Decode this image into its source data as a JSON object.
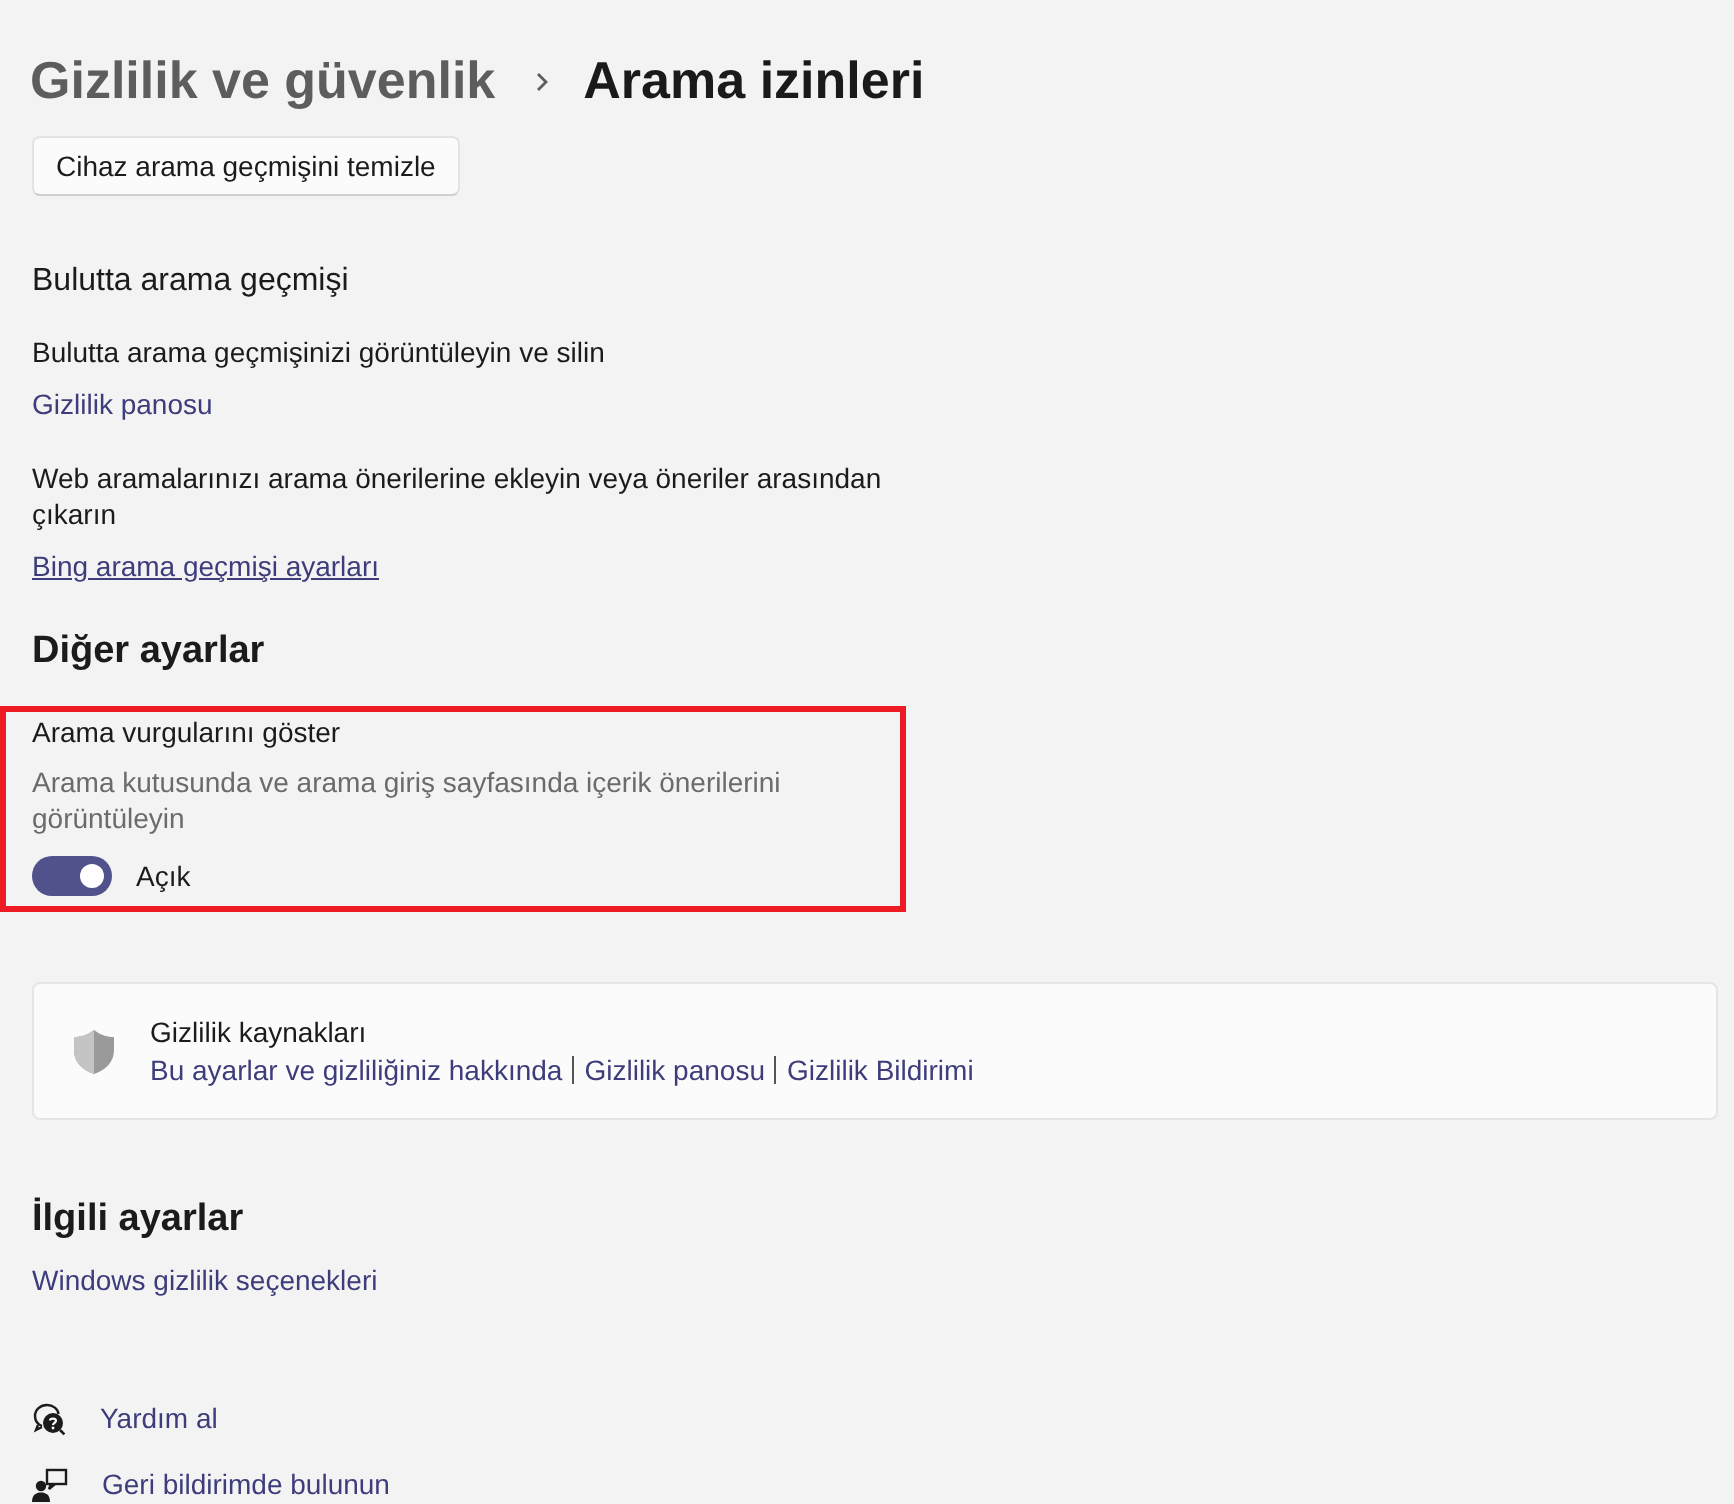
{
  "breadcrumb": {
    "parent": "Gizlilik ve güvenlik",
    "current": "Arama izinleri"
  },
  "clear_history_button": {
    "label": "Cihaz arama geçmişini temizle"
  },
  "cloud_history": {
    "title": "Bulutta arama geçmişi",
    "items": [
      {
        "description": "Bulutta arama geçmişinizi görüntüleyin ve silin",
        "link": "Gizlilik panosu",
        "hovered": false
      },
      {
        "description": "Web aramalarınızı arama önerilerine ekleyin veya öneriler arasından çıkarın",
        "link": "Bing arama geçmişi ayarları",
        "hovered": true
      }
    ]
  },
  "other_settings": {
    "title": "Diğer ayarlar",
    "settings": [
      {
        "title": "Arama vurgularını göster",
        "description": "Arama kutusunda ve arama giriş sayfasında içerik önerilerini görüntüleyin",
        "on": true,
        "state_label": "Açık",
        "highlighted": true
      }
    ]
  },
  "privacy_resources": {
    "title": "Gizlilik kaynakları",
    "links": [
      "Bu ayarlar ve gizliliğiniz hakkında",
      "Gizlilik panosu",
      "Gizlilik Bildirimi"
    ]
  },
  "related_settings": {
    "title": "İlgili ayarlar",
    "links": [
      "Windows gizlilik seçenekleri"
    ]
  },
  "help_links": [
    {
      "kind": "help",
      "label": "Yardım al"
    },
    {
      "kind": "feedback",
      "label": "Geri bildirimde bulunun"
    }
  ]
}
